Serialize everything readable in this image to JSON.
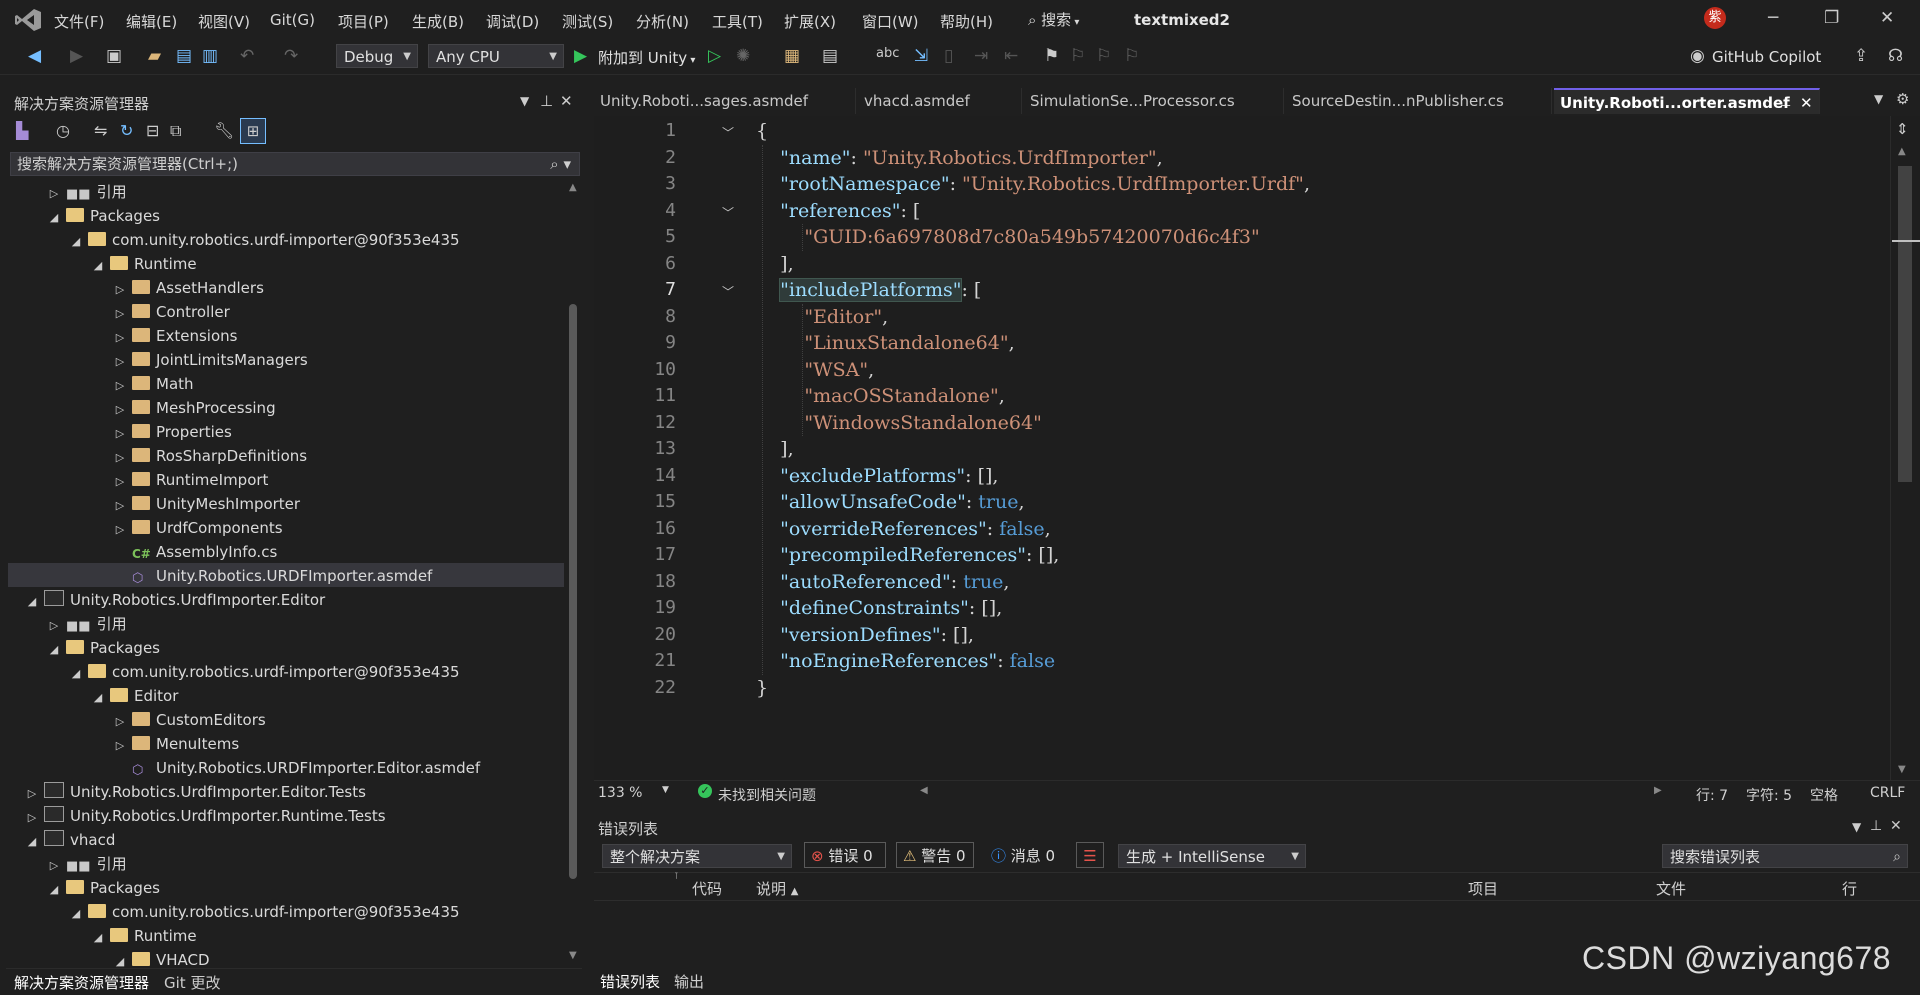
{
  "colors": {
    "accent": "#7160e8",
    "run_green": "#35c55b",
    "error_red": "#e5534b",
    "warning_yellow": "#e5c07b",
    "info_blue": "#3794ff"
  },
  "menubar": {
    "items": [
      "文件(F)",
      "编辑(E)",
      "视图(V)",
      "Git(G)",
      "项目(P)",
      "生成(B)",
      "调试(D)",
      "测试(S)",
      "分析(N)",
      "工具(T)",
      "扩展(X)",
      "窗口(W)",
      "帮助(H)"
    ],
    "search_label": "搜索",
    "solution_title": "textmixed2",
    "avatar_initial": "紫"
  },
  "toolbar": {
    "config": "Debug",
    "platform": "Any CPU",
    "attach_label": "附加到 Unity",
    "copilot_label": "GitHub Copilot"
  },
  "solution_explorer": {
    "title": "解决方案资源管理器",
    "search_placeholder": "搜索解决方案资源管理器(Ctrl+;)",
    "rows": [
      {
        "label": "引用",
        "depth": 1,
        "icon": "references-icon",
        "state": "collapsed"
      },
      {
        "label": "Packages",
        "depth": 1,
        "icon": "folder-open-icon",
        "state": "expanded"
      },
      {
        "label": "com.unity.robotics.urdf-importer@90f353e435",
        "depth": 2,
        "icon": "folder-open-icon",
        "state": "expanded"
      },
      {
        "label": "Runtime",
        "depth": 3,
        "icon": "folder-open-icon",
        "state": "expanded"
      },
      {
        "label": "AssetHandlers",
        "depth": 4,
        "icon": "folder-icon",
        "state": "collapsed"
      },
      {
        "label": "Controller",
        "depth": 4,
        "icon": "folder-icon",
        "state": "collapsed"
      },
      {
        "label": "Extensions",
        "depth": 4,
        "icon": "folder-icon",
        "state": "collapsed"
      },
      {
        "label": "JointLimitsManagers",
        "depth": 4,
        "icon": "folder-icon",
        "state": "collapsed"
      },
      {
        "label": "Math",
        "depth": 4,
        "icon": "folder-icon",
        "state": "collapsed"
      },
      {
        "label": "MeshProcessing",
        "depth": 4,
        "icon": "folder-icon",
        "state": "collapsed"
      },
      {
        "label": "Properties",
        "depth": 4,
        "icon": "folder-icon",
        "state": "collapsed"
      },
      {
        "label": "RosSharpDefinitions",
        "depth": 4,
        "icon": "folder-icon",
        "state": "collapsed"
      },
      {
        "label": "RuntimeImport",
        "depth": 4,
        "icon": "folder-icon",
        "state": "collapsed"
      },
      {
        "label": "UnityMeshImporter",
        "depth": 4,
        "icon": "folder-icon",
        "state": "collapsed"
      },
      {
        "label": "UrdfComponents",
        "depth": 4,
        "icon": "folder-icon",
        "state": "collapsed"
      },
      {
        "label": "AssemblyInfo.cs",
        "depth": 4,
        "icon": "csharp-file-icon",
        "state": "leaf"
      },
      {
        "label": "Unity.Robotics.URDFImporter.asmdef",
        "depth": 4,
        "icon": "asmdef-file-icon",
        "state": "leaf"
      },
      {
        "label": "Unity.Robotics.UrdfImporter.Editor",
        "depth": 0,
        "icon": "project-icon",
        "state": "expanded"
      },
      {
        "label": "引用",
        "depth": 1,
        "icon": "references-icon",
        "state": "collapsed"
      },
      {
        "label": "Packages",
        "depth": 1,
        "icon": "folder-open-icon",
        "state": "expanded"
      },
      {
        "label": "com.unity.robotics.urdf-importer@90f353e435",
        "depth": 2,
        "icon": "folder-open-icon",
        "state": "expanded"
      },
      {
        "label": "Editor",
        "depth": 3,
        "icon": "folder-open-icon",
        "state": "expanded"
      },
      {
        "label": "CustomEditors",
        "depth": 4,
        "icon": "folder-icon",
        "state": "collapsed"
      },
      {
        "label": "MenuItems",
        "depth": 4,
        "icon": "folder-icon",
        "state": "collapsed"
      },
      {
        "label": "Unity.Robotics.URDFImporter.Editor.asmdef",
        "depth": 4,
        "icon": "asmdef-file-icon",
        "state": "leaf"
      },
      {
        "label": "Unity.Robotics.UrdfImporter.Editor.Tests",
        "depth": 0,
        "icon": "project-icon",
        "state": "collapsed"
      },
      {
        "label": "Unity.Robotics.UrdfImporter.Runtime.Tests",
        "depth": 0,
        "icon": "project-icon",
        "state": "collapsed"
      },
      {
        "label": "vhacd",
        "depth": 0,
        "icon": "project-icon",
        "state": "expanded"
      },
      {
        "label": "引用",
        "depth": 1,
        "icon": "references-icon",
        "state": "collapsed"
      },
      {
        "label": "Packages",
        "depth": 1,
        "icon": "folder-open-icon",
        "state": "expanded"
      },
      {
        "label": "com.unity.robotics.urdf-importer@90f353e435",
        "depth": 2,
        "icon": "folder-open-icon",
        "state": "expanded"
      },
      {
        "label": "Runtime",
        "depth": 3,
        "icon": "folder-open-icon",
        "state": "expanded"
      },
      {
        "label": "VHACD",
        "depth": 4,
        "icon": "folder-open-icon",
        "state": "expanded"
      }
    ],
    "selected_label": "Unity.Robotics.URDFImporter.asmdef",
    "bottom_tabs": [
      "解决方案资源管理器",
      "Git 更改"
    ]
  },
  "editor": {
    "tabs": [
      "Unity.Roboti...sages.asmdef",
      "vhacd.asmdef",
      "SimulationSe...Processor.cs",
      "SourceDestin...nPublisher.cs",
      "Unity.Roboti...orter.asmdef"
    ],
    "active_tab": "Unity.Roboti...orter.asmdef",
    "lines": [
      "{",
      "    \"name\": \"Unity.Robotics.UrdfImporter\",",
      "    \"rootNamespace\": \"Unity.Robotics.UrdfImporter.Urdf\",",
      "    \"references\": [",
      "        \"GUID:6a697808d7c80a549b57420070d6c4f3\"",
      "    ],",
      "    \"includePlatforms\": [",
      "        \"Editor\",",
      "        \"LinuxStandalone64\",",
      "        \"WSA\",",
      "        \"macOSStandalone\",",
      "        \"WindowsStandalone64\"",
      "    ],",
      "    \"excludePlatforms\": [],",
      "    \"allowUnsafeCode\": true,",
      "    \"overrideReferences\": false,",
      "    \"precompiledReferences\": [],",
      "    \"autoReferenced\": true,",
      "    \"defineConstraints\": [],",
      "    \"versionDefines\": [],",
      "    \"noEngineReferences\": false",
      "}"
    ],
    "current_line": 7
  },
  "status": {
    "zoom": "133 %",
    "issues": "未找到相关问题",
    "line": "行: 7",
    "column": "字符: 5",
    "whitespace": "空格",
    "line_ending": "CRLF"
  },
  "error_list": {
    "title": "错误列表",
    "scope": "整个解决方案",
    "errors": "错误 0",
    "warnings": "警告 0",
    "messages": "消息 0",
    "source": "生成 + IntelliSense",
    "search_placeholder": "搜索错误列表",
    "columns": [
      "代码",
      "说明",
      "项目",
      "文件",
      "行"
    ],
    "bottom_tabs": [
      "错误列表",
      "输出"
    ]
  },
  "watermark": "CSDN @wziyang678"
}
